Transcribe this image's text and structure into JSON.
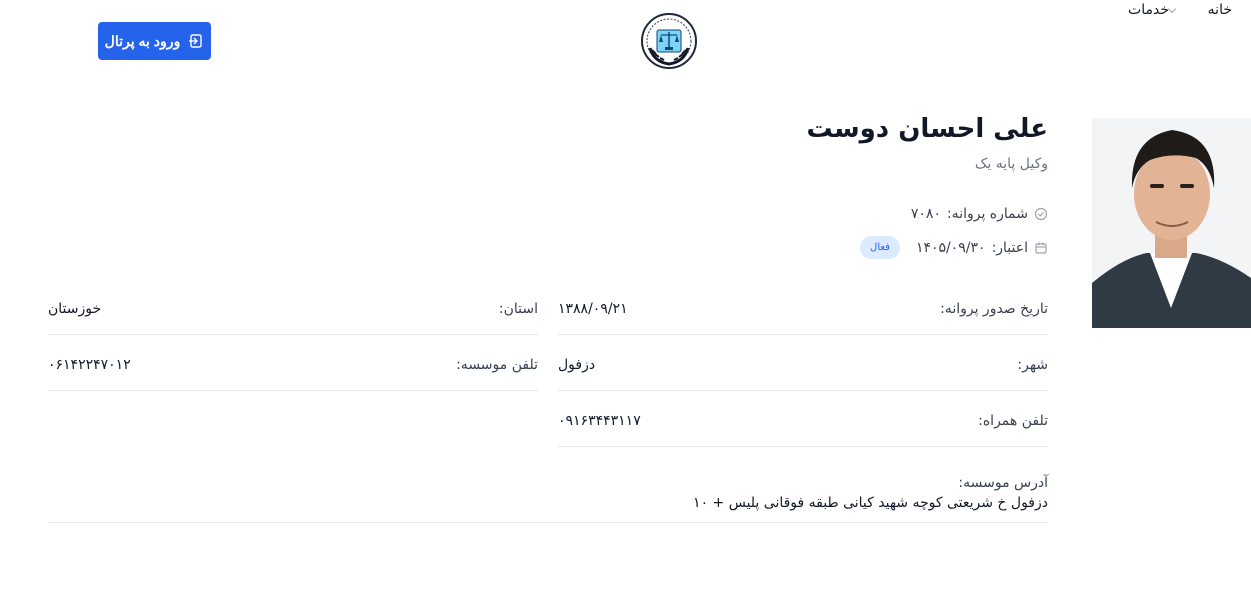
{
  "nav": {
    "home": "خانه",
    "services": "خدمات"
  },
  "portal_button": {
    "label": "ورود به پرتال"
  },
  "profile": {
    "name": "علی احسان دوست",
    "title": "وکیل پایه یک",
    "license_number_label": "شماره پروانه:",
    "license_number": "۷۰۸۰",
    "validity_label": "اعتبار:",
    "validity": "۱۴۰۵/۰۹/۳۰",
    "status": "فعال"
  },
  "details": {
    "issue_date_label": "تاریخ صدور پروانه:",
    "issue_date": "۱۳۸۸/۰۹/۲۱",
    "province_label": "استان:",
    "province": "خوزستان",
    "city_label": "شهر:",
    "city": "دزفول",
    "office_phone_label": "تلفن موسسه:",
    "office_phone": "۰۶۱۴۲۲۴۷۰۱۲",
    "mobile_label": "تلفن همراه:",
    "mobile": "۰۹۱۶۳۴۴۳۱۱۷",
    "address_label": "آدرس موسسه:",
    "address": "دزفول خ شریعتی کوچه شهید کیانی طبقه فوقانی پلیس + ۱۰"
  },
  "colors": {
    "primary": "#2563eb",
    "badge_bg": "#dbeafe",
    "divider": "#e5e7eb"
  },
  "icons": {
    "portal": "login-arrow-icon",
    "license": "check-circle-icon",
    "validity": "calendar-icon",
    "services": "chevron-down-icon",
    "logo": "bar-association-logo"
  }
}
